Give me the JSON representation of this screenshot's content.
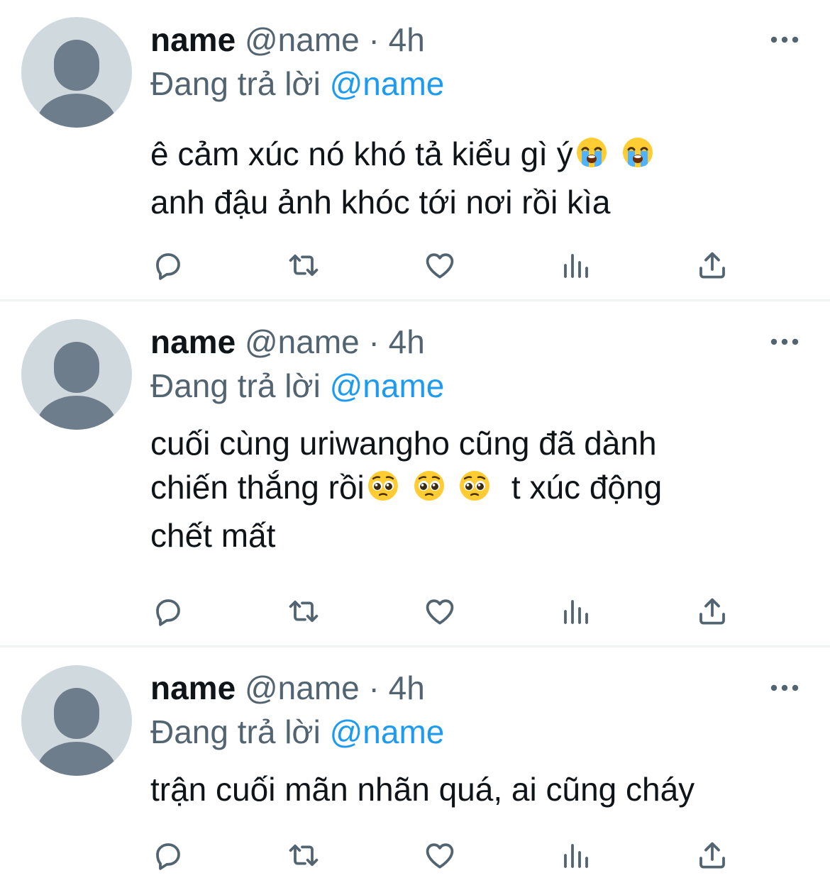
{
  "colors": {
    "accent": "#1d9bf0",
    "muted": "#536471",
    "text": "#0f1419",
    "avatar_bg": "#cfd9de",
    "avatar_fg": "#6e7d8b"
  },
  "icons": {
    "more": "more-dots-icon",
    "reply": "reply-icon",
    "retweet": "retweet-icon",
    "like": "heart-icon",
    "views": "analytics-icon",
    "share": "share-icon"
  },
  "tweets": [
    {
      "name": "name",
      "handle": "@name",
      "separator": " · ",
      "time": "4h",
      "reply_prefix": "Đang trả lời ",
      "reply_to": "@name",
      "lines": [
        {
          "pre": "ê cảm xúc nó khó tả kiểu gì ý",
          "emojis": [
            "loudly-crying-face-emoji",
            "loudly-crying-face-emoji"
          ],
          "post": ""
        },
        {
          "pre": "anh đậu ảnh khóc tới nơi rồi kìa",
          "emojis": [],
          "post": ""
        }
      ]
    },
    {
      "name": "name",
      "handle": "@name",
      "separator": " · ",
      "time": "4h",
      "reply_prefix": "Đang trả lời ",
      "reply_to": "@name",
      "lines": [
        {
          "pre": "cuối cùng uriwangho cũng đã dành",
          "emojis": [],
          "post": ""
        },
        {
          "pre": "chiến thắng rồi",
          "emojis": [
            "pleading-face-emoji",
            "pleading-face-emoji",
            "pleading-face-emoji"
          ],
          "post": " t xúc động"
        },
        {
          "pre": "chết mất",
          "emojis": [],
          "post": ""
        }
      ]
    },
    {
      "name": "name",
      "handle": "@name",
      "separator": " · ",
      "time": "4h",
      "reply_prefix": "Đang trả lời ",
      "reply_to": "@name",
      "lines": [
        {
          "pre": "trận cuối mãn nhãn quá, ai cũng cháy",
          "emojis": [],
          "post": ""
        }
      ]
    }
  ]
}
